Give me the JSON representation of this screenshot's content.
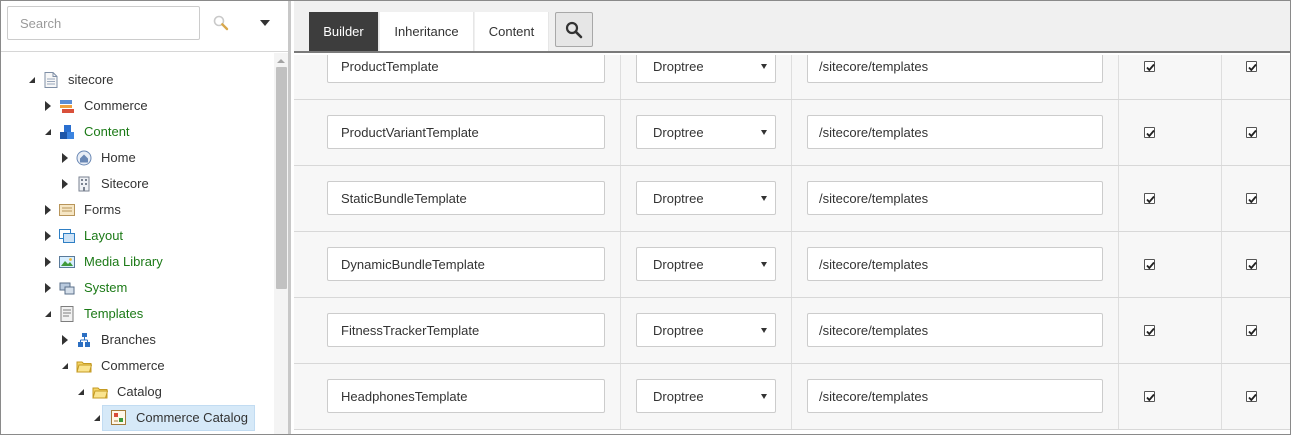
{
  "search": {
    "placeholder": "Search",
    "value": ""
  },
  "tree": [
    {
      "label": "sitecore",
      "icon": "document-icon",
      "color": "dark",
      "state": "expanded"
    },
    {
      "label": "Commerce",
      "icon": "commerce-icon",
      "color": "dark",
      "state": "collapsed"
    },
    {
      "label": "Content",
      "icon": "cubes-icon",
      "color": "green",
      "state": "expanded"
    },
    {
      "label": "Home",
      "icon": "home-icon",
      "color": "dark",
      "state": "collapsed"
    },
    {
      "label": "Sitecore",
      "icon": "building-icon",
      "color": "dark",
      "state": "collapsed"
    },
    {
      "label": "Forms",
      "icon": "forms-icon",
      "color": "dark",
      "state": "collapsed"
    },
    {
      "label": "Layout",
      "icon": "layout-icon",
      "color": "green",
      "state": "collapsed"
    },
    {
      "label": "Media Library",
      "icon": "media-icon",
      "color": "green",
      "state": "collapsed"
    },
    {
      "label": "System",
      "icon": "system-icon",
      "color": "green",
      "state": "collapsed"
    },
    {
      "label": "Templates",
      "icon": "templates-icon",
      "color": "green",
      "state": "expanded"
    },
    {
      "label": "Branches",
      "icon": "branches-icon",
      "color": "dark",
      "state": "collapsed"
    },
    {
      "label": "Commerce",
      "icon": "folder-icon",
      "color": "dark",
      "state": "expanded"
    },
    {
      "label": "Catalog",
      "icon": "folder-icon",
      "color": "dark",
      "state": "expanded"
    },
    {
      "label": "Commerce Catalog",
      "icon": "catalog-template-icon",
      "color": "dark",
      "state": "expanded",
      "selected": true
    }
  ],
  "tabs": [
    {
      "label": "Builder",
      "active": true
    },
    {
      "label": "Inheritance",
      "active": false
    },
    {
      "label": "Content",
      "active": false
    }
  ],
  "fields": [
    {
      "name": "ProductTemplate",
      "type": "Droptree",
      "source": "/sitecore/templates",
      "unversioned": true,
      "shared": true
    },
    {
      "name": "ProductVariantTemplate",
      "type": "Droptree",
      "source": "/sitecore/templates",
      "unversioned": true,
      "shared": true
    },
    {
      "name": "StaticBundleTemplate",
      "type": "Droptree",
      "source": "/sitecore/templates",
      "unversioned": true,
      "shared": true
    },
    {
      "name": "DynamicBundleTemplate",
      "type": "Droptree",
      "source": "/sitecore/templates",
      "unversioned": true,
      "shared": true
    },
    {
      "name": "FitnessTrackerTemplate",
      "type": "Droptree",
      "source": "/sitecore/templates",
      "unversioned": true,
      "shared": true
    },
    {
      "name": "HeadphonesTemplate",
      "type": "Droptree",
      "source": "/sitecore/templates",
      "unversioned": true,
      "shared": true
    }
  ],
  "colors": {
    "green": "#1c7a17",
    "active_tab": "#3d3d3d",
    "selection": "#d6e9f8"
  }
}
